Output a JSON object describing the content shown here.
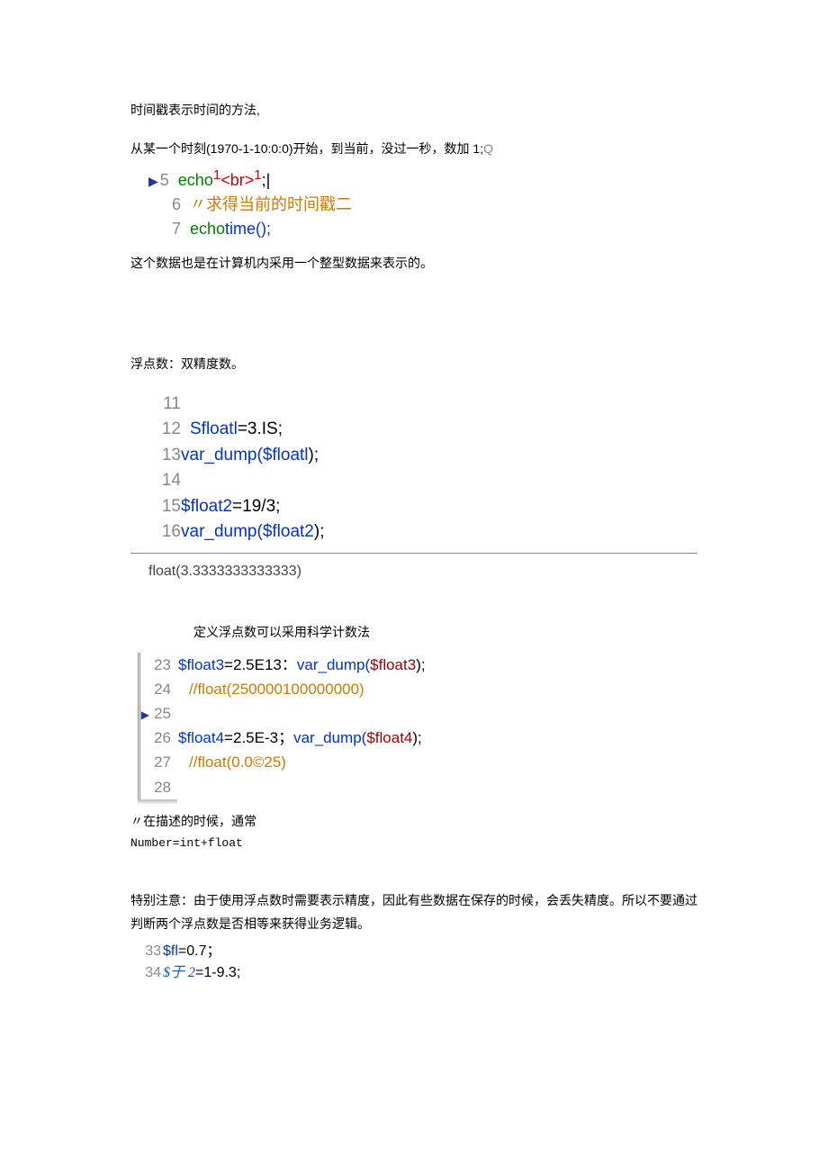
{
  "p1": "时间戳表示时间的方法,",
  "p2_a": "从某一个时刻(",
  "p2_b": "1970-1-10:0:0)",
  "p2_c": "开始，到当前，没过一秒，数加 1;",
  "cursor": "Q",
  "block1": {
    "line5": {
      "no": "5",
      "seg1": "echo",
      "seg2": "1",
      "seg3": "<br>",
      "seg4": "1",
      "tail": ";|"
    },
    "line6": {
      "no": "6",
      "cmt": "〃求得当前的时间戳二"
    },
    "line7": {
      "no": "7",
      "e": "echo",
      "t": "time();"
    }
  },
  "p3": "这个数据也是在计算机内采用一个整型数据来表示的。",
  "p4": "浮点数：双精度数。",
  "block2": {
    "l11": "11",
    "l12": {
      "no": "12",
      "v": "Sfloatl",
      "eq": "=",
      "rhs": "3.IS;"
    },
    "l13": {
      "no": "13",
      "fn": "var_dump(",
      "v": "$floatl",
      "tail": ");"
    },
    "l14": "14",
    "l15": {
      "no": "15",
      "v": "$float2",
      "eq": "=",
      "rhs": "19/3;"
    },
    "l16": {
      "no": "16",
      "fn": "var_dump(",
      "v": "$float2",
      "tail": ");"
    }
  },
  "output1": "float(3.3333333333333)",
  "p5": "定义浮点数可以采用科学计数法",
  "block3": {
    "l23": {
      "no": "23",
      "v": "$float3",
      "eq": "=",
      "rhs": "2.5E13：",
      "fn": "var_dump(",
      "v2": "$float3",
      "tail": ");"
    },
    "l24": {
      "no": "24",
      "cmt": "//float(250000100000000)"
    },
    "l25": {
      "no": "25"
    },
    "l26": {
      "no": "26",
      "v": "$float4",
      "eq": "=",
      "rhs": "2.5E-3；",
      "fn": "var_dump(",
      "v2": "$float4",
      "tail": ");"
    },
    "l27": {
      "no": "27",
      "cmt": "//float(0.0©25)"
    },
    "l28": {
      "no": "28"
    }
  },
  "p6": "〃在描述的时候，通常",
  "p7": "Number=int+float",
  "p8": "特别注意：由于使用浮点数时需要表示精度，因此有些数据在保存的时候，会丢失精度。所以不要通过判断两个浮点数是否相等来获得业务逻辑。",
  "block4": {
    "l33": {
      "no": "33",
      "v": "$fl",
      "eq": "=",
      "rhs": "0.7；"
    },
    "l34": {
      "no": "34",
      "v": "$于 2",
      "eq": "=",
      "rhs": "1-9.3;"
    }
  }
}
